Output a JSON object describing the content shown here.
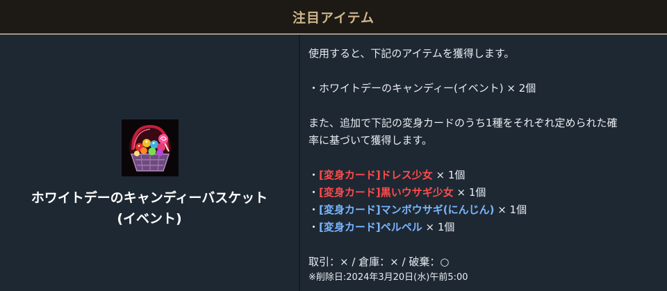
{
  "header": {
    "title": "注目アイテム"
  },
  "item": {
    "icon": "candy-basket-icon",
    "name_line1": "ホワイトデーのキャンディーバスケット",
    "name_line2": "(イベント)"
  },
  "description": {
    "intro": "使用すると、下記のアイテムを獲得します。",
    "reward": "・ホワイトデーのキャンディー(イベント) × 2個",
    "extra_line1": "また、追加で下記の変身カードのうち1種をそれぞれ定められた確",
    "extra_line2": "率に基づいて獲得します。",
    "cards": [
      {
        "bullet": "・",
        "name": "[変身カード]ドレス少女",
        "qty": " × 1個",
        "color": "#ff4b4b"
      },
      {
        "bullet": "・",
        "name": "[変身カード]黒いウサギ少女",
        "qty": " × 1個",
        "color": "#ff4b4b"
      },
      {
        "bullet": "・",
        "name": "[変身カード]マンボウサギ(にんじん)",
        "qty": " × 1個",
        "color": "#79b6ff"
      },
      {
        "bullet": "・",
        "name": "[変身カード]ペルペル",
        "qty": " × 1個",
        "color": "#79b6ff"
      }
    ],
    "trade": "取引：× / 倉庫：× / 破棄：○",
    "deletion": "※削除日:2024年3月20日(水)午前5:00"
  },
  "colors": {
    "header_bg": "#1d1914",
    "header_text": "#cdb68b",
    "panel_bg": "#1e2833",
    "highlight_red": "#ff4b4b",
    "highlight_blue": "#79b6ff"
  }
}
